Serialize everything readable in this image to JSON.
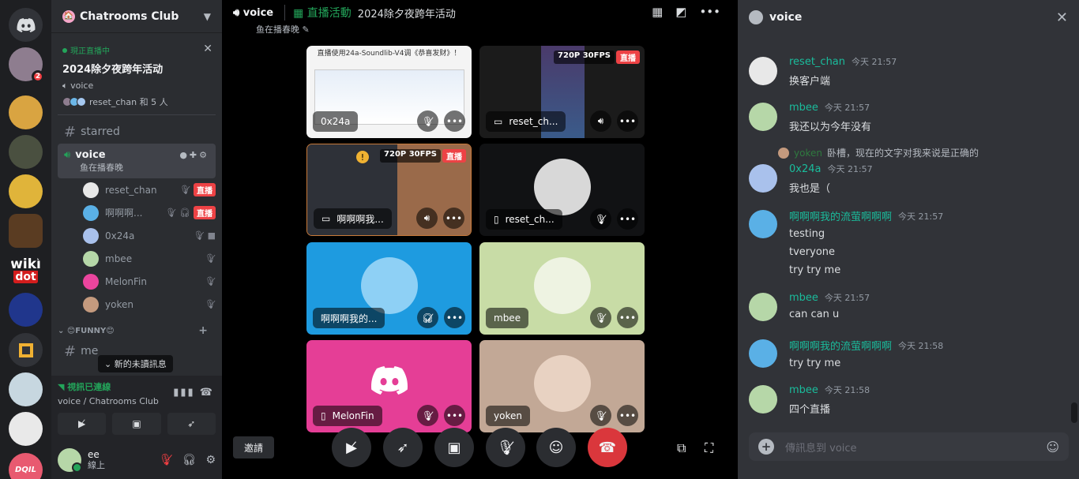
{
  "guild": {
    "name": "Chatrooms Club"
  },
  "rail": {
    "badge": "2",
    "wiki_line1": "wiki",
    "wiki_line2": "dot",
    "bottom_label": "DQIL"
  },
  "live_card": {
    "tag": "現正直播中",
    "title": "2024除夕夜跨年活动",
    "channel": "voice",
    "people": "reset_chan 和 5 人"
  },
  "channels": {
    "starred": "starred",
    "voice": {
      "name": "voice",
      "status": "鱼在播春晚"
    },
    "voice_users": [
      {
        "name": "reset_chan",
        "live": "直播"
      },
      {
        "name": "啊啊啊...",
        "live": "直播"
      },
      {
        "name": "0x24a"
      },
      {
        "name": "mbee"
      },
      {
        "name": "MelonFin"
      },
      {
        "name": "yoken"
      }
    ],
    "category": "😊FUNNY😊",
    "me_channel": "me",
    "new_unread": "新的未讀訊息"
  },
  "rtc": {
    "status": "視訊已連線",
    "path": "voice / Chatrooms Club"
  },
  "user": {
    "name": "ee",
    "status": "線上"
  },
  "stage": {
    "channel": "voice",
    "event_label": "直播活動",
    "event_name": "2024除夕夜跨年活动",
    "status": "鱼在播春晚",
    "invite": "邀請",
    "tiles": [
      {
        "name": "0x24a",
        "banner": "直播使用24a-Soundlib-V4调《恭喜发财》！"
      },
      {
        "name": "reset_ch...",
        "quality": "720P 30FPS",
        "live": "直播"
      },
      {
        "name": "啊啊啊我...",
        "quality": "720P 30FPS",
        "live": "直播"
      },
      {
        "name": "reset_ch..."
      },
      {
        "name": "啊啊啊我的..."
      },
      {
        "name": "mbee"
      },
      {
        "name": "MelonFin"
      },
      {
        "name": "yoken"
      }
    ]
  },
  "chat": {
    "title": "voice",
    "placeholder": "傳訊息到 voice",
    "reply": {
      "name": "yoken",
      "text": "卧槽，现在的文字对我来说是正确的"
    },
    "messages": [
      {
        "author": "reset_chan",
        "time": "今天 21:57",
        "lines": [
          "换客户端"
        ]
      },
      {
        "author": "mbee",
        "time": "今天 21:57",
        "lines": [
          "我还以为今年没有"
        ]
      },
      {
        "author": "0x24a",
        "time": "今天 21:57",
        "lines": [
          "我也是（"
        ]
      },
      {
        "author": "啊啊啊我的流萤啊啊啊",
        "time": "今天 21:57",
        "lines": [
          "testing",
          "tveryone",
          "try try me"
        ]
      },
      {
        "author": "mbee",
        "time": "今天 21:57",
        "lines": [
          "can can u"
        ]
      },
      {
        "author": "啊啊啊我的流萤啊啊啊",
        "time": "今天 21:58",
        "lines": [
          "try try me"
        ]
      },
      {
        "author": "mbee",
        "time": "今天 21:58",
        "lines": [
          "四个直播"
        ]
      }
    ]
  },
  "colors": {
    "accent_green": "#23a55a",
    "live_red": "#ed4245",
    "end_call": "#da373c",
    "author_teal": "#1abc9c"
  }
}
